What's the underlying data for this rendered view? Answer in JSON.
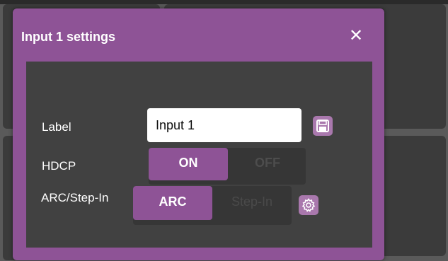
{
  "modal": {
    "title": "Input 1 settings",
    "close_symbol": "✕"
  },
  "fields": {
    "label": {
      "label": "Label",
      "value": "Input 1",
      "save_icon": "save-icon"
    },
    "hdcp": {
      "label": "HDCP",
      "options": [
        "ON",
        "OFF"
      ],
      "selected": "ON"
    },
    "arc": {
      "label": "ARC/Step-In",
      "options": [
        "ARC",
        "Step-In"
      ],
      "selected": "ARC",
      "settings_icon": "gear-icon"
    }
  },
  "colors": {
    "accent": "#8e5396",
    "button": "#a978ad",
    "body": "#414141"
  }
}
